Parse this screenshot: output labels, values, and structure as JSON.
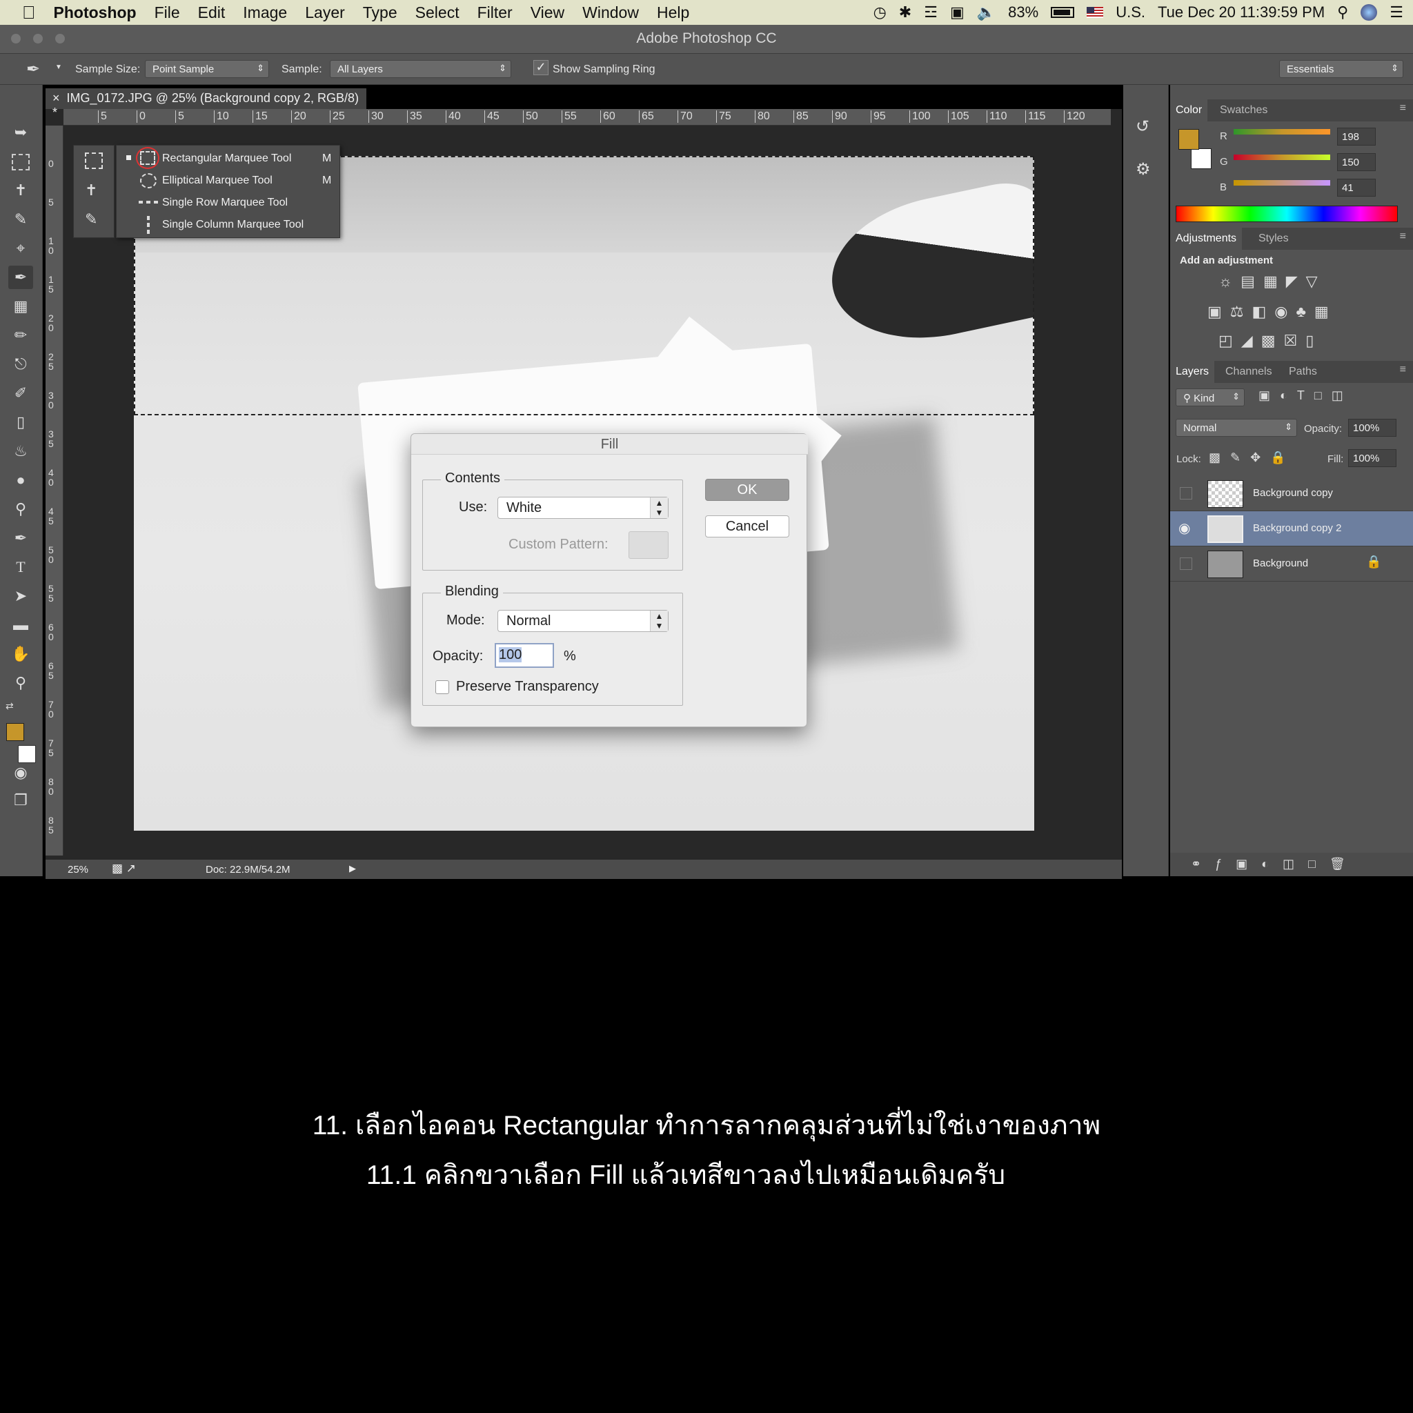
{
  "menubar": {
    "apple": "",
    "app": "Photoshop",
    "items": [
      "File",
      "Edit",
      "Image",
      "Layer",
      "Type",
      "Select",
      "Filter",
      "View",
      "Window",
      "Help"
    ],
    "battery": "83%",
    "input_source": "U.S.",
    "datetime": "Tue Dec 20  11:39:59 PM"
  },
  "window": {
    "title": "Adobe Photoshop CC"
  },
  "options": {
    "sample_size_label": "Sample Size:",
    "sample_size_value": "Point Sample",
    "sample_label": "Sample:",
    "sample_value": "All Layers",
    "show_ring_label": "Show Sampling Ring",
    "workspace": "Essentials"
  },
  "document": {
    "tab_title": "IMG_0172.JPG @ 25% (Background copy 2, RGB/8) *",
    "zoom": "25%",
    "doc_info": "Doc: 22.9M/54.2M",
    "ruler_top": [
      "5",
      "0",
      "5",
      "10",
      "15",
      "20",
      "25",
      "30",
      "35",
      "40",
      "45",
      "50",
      "55",
      "60",
      "65",
      "70",
      "75",
      "80",
      "85",
      "90",
      "95",
      "100",
      "105",
      "110",
      "115",
      "120"
    ],
    "ruler_left": [
      "0",
      "5",
      "10",
      "15",
      "20",
      "25",
      "30",
      "35",
      "40",
      "45",
      "50",
      "55",
      "60",
      "65",
      "70",
      "75",
      "80",
      "85"
    ]
  },
  "flyout": {
    "items": [
      {
        "label": "Rectangular Marquee Tool",
        "key": "M"
      },
      {
        "label": "Elliptical Marquee Tool",
        "key": "M"
      },
      {
        "label": "Single Row Marquee Tool",
        "key": ""
      },
      {
        "label": "Single Column Marquee Tool",
        "key": ""
      }
    ]
  },
  "color_panel": {
    "tabs": [
      "Color",
      "Swatches"
    ],
    "r_label": "R",
    "r": "198",
    "g_label": "G",
    "g": "150",
    "b_label": "B",
    "b": "41",
    "fg_color": "#c6962a"
  },
  "adjustments_panel": {
    "tabs": [
      "Adjustments",
      "Styles"
    ],
    "heading": "Add an adjustment"
  },
  "layers_panel": {
    "tabs": [
      "Layers",
      "Channels",
      "Paths"
    ],
    "filter": "Kind",
    "blend_mode": "Normal",
    "opacity_label": "Opacity:",
    "opacity": "100%",
    "lock_label": "Lock:",
    "fill_label": "Fill:",
    "fill": "100%",
    "layers": [
      {
        "name": "Background copy",
        "visible": false,
        "selected": false
      },
      {
        "name": "Background copy 2",
        "visible": true,
        "selected": true
      },
      {
        "name": "Background",
        "visible": false,
        "selected": false
      }
    ]
  },
  "fill_dialog": {
    "title": "Fill",
    "contents_legend": "Contents",
    "use_label": "Use:",
    "use_value": "White",
    "custom_pattern_label": "Custom Pattern:",
    "blending_legend": "Blending",
    "mode_label": "Mode:",
    "mode_value": "Normal",
    "opacity_label": "Opacity:",
    "opacity_value": "100",
    "opacity_unit": "%",
    "preserve_label": "Preserve Transparency",
    "ok": "OK",
    "cancel": "Cancel"
  },
  "caption": {
    "line1": "11. เลือกไอคอน Rectangular ทำการลากคลุมส่วนที่ไม่ใช่เงาของภาพ",
    "line2": "11.1 คลิกขวาเลือก Fill แล้วเทสีขาวลงไปเหมือนเดิมครับ"
  },
  "colors": {
    "accent": "#8fa2c6",
    "selected_layer": "#6d7f9f"
  }
}
